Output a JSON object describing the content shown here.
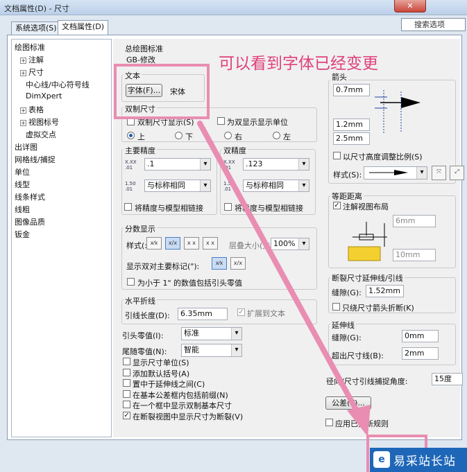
{
  "window": {
    "title": "文档属性(D) - 尺寸",
    "close_glyph": "✕"
  },
  "tabs": [
    {
      "label": "系统选项(S)"
    },
    {
      "label": "文档属性(D)"
    }
  ],
  "search": {
    "placeholder": "搜索选项"
  },
  "tree": {
    "items": [
      {
        "label": "绘图标准",
        "expand": ""
      },
      {
        "label": "注解",
        "expand": "+"
      },
      {
        "label": "尺寸",
        "expand": "+"
      },
      {
        "label": "中心线/中心符号线",
        "expand": ""
      },
      {
        "label": "DimXpert",
        "expand": ""
      },
      {
        "label": "表格",
        "expand": "+"
      },
      {
        "label": "视图标号",
        "expand": "+"
      },
      {
        "label": "虚拟交点",
        "expand": ""
      },
      {
        "label": "出详图",
        "expand": ""
      },
      {
        "label": "网格线/捕捉",
        "expand": ""
      },
      {
        "label": "单位",
        "expand": ""
      },
      {
        "label": "线型",
        "expand": ""
      },
      {
        "label": "线条样式",
        "expand": ""
      },
      {
        "label": "线粗",
        "expand": ""
      },
      {
        "label": "图像品质",
        "expand": ""
      },
      {
        "label": "钣金",
        "expand": ""
      }
    ]
  },
  "overall_standard": {
    "label": "总绘图标准",
    "value": "GB-修改"
  },
  "annotation_text": "可以看到字体已经变更",
  "text_group": {
    "label": "文本",
    "font_button": "字体(F)...",
    "font_name": "宋体"
  },
  "dual_dim": {
    "label": "双制尺寸",
    "show_dual": "双制尺寸显示(S)",
    "show_units": "为双显示显示单位",
    "pos_top": "上",
    "pos_bottom": "下",
    "pos_right": "右",
    "pos_left": "左"
  },
  "primary_precision": {
    "label": "主要精度",
    "value1": ".1",
    "value2": "与标称相同",
    "link": "将精度与模型相链接",
    "icon1": "X.XX .01",
    "icon2": "1.50 .01"
  },
  "dual_precision": {
    "label": "双精度",
    "value1": ".123",
    "value2": "与标称相同",
    "link": "将精度与模型相链接",
    "icon1": "X.XX .01",
    "icon2": "1.50 .01"
  },
  "fraction": {
    "label": "分数显示",
    "style_label": "样式(:",
    "stack_size": "100%",
    "overlay_text": "层叠大小(文",
    "show_dual_label": "显示双对主要标记(\"):",
    "leading_zero": "为小于 1\" 的数值包括引头零值",
    "style_icons": [
      "x⁄x",
      "x/x",
      "x x",
      "x x"
    ],
    "dual_icons": [
      "x⁄x",
      "x/x"
    ]
  },
  "horizontal_break": {
    "label": "水平折线",
    "leader_length_label": "引线长度(D):",
    "leader_length": "6.35mm",
    "extend_to_text": "扩展到文本"
  },
  "zeros": {
    "leading_label": "引头零值(I):",
    "leading_value": "标准",
    "trailing_label": "尾随零值(N):",
    "trailing_value": "智能"
  },
  "options": [
    {
      "label": "显示尺寸单位(S)",
      "checked": false
    },
    {
      "label": "添加默认括号(A)",
      "checked": false
    },
    {
      "label": "置中于延伸线之间(C)",
      "checked": false
    },
    {
      "label": "在基本公差框内包括前缀(N)",
      "checked": false
    },
    {
      "label": "在一个框中显示双制基本尺寸",
      "checked": false
    },
    {
      "label": "在断裂视图中显示尺寸为断裂(V)",
      "checked": true
    }
  ],
  "arrows": {
    "label": "箭头",
    "size1": "0.7mm",
    "size2": "1.2mm",
    "size3": "2.5mm",
    "scale_with_height": "以尺寸高度调整比例(S)",
    "style_label": "样式(S):"
  },
  "offset": {
    "label": "等距距离",
    "note_layout": "注解视图布局",
    "value1": "6mm",
    "value2": "10mm"
  },
  "break_ext": {
    "label": "断裂尺寸延伸线/引线",
    "gap_label": "缝隙(G):",
    "gap_value": "1.52mm",
    "only_arrow": "只绕尺寸箭头折断(K)"
  },
  "extension_lines": {
    "label": "延伸线",
    "gap_label": "缝隙(G):",
    "gap_value": "0mm",
    "beyond_label": "超出尺寸线(B):",
    "beyond_value": "2mm"
  },
  "radial_snap": {
    "label": "径向/尺寸引线捕捉角度:",
    "value": "15度"
  },
  "tolerance_button": "公差(T)...",
  "apply_updated": "应用已更新规则",
  "watermark": {
    "logo": "e",
    "text": "易采站长站"
  },
  "colors": {
    "annotation": "#e0407a",
    "highlight_box": "#e98db2",
    "watermark_bg": "#1e67b8"
  }
}
